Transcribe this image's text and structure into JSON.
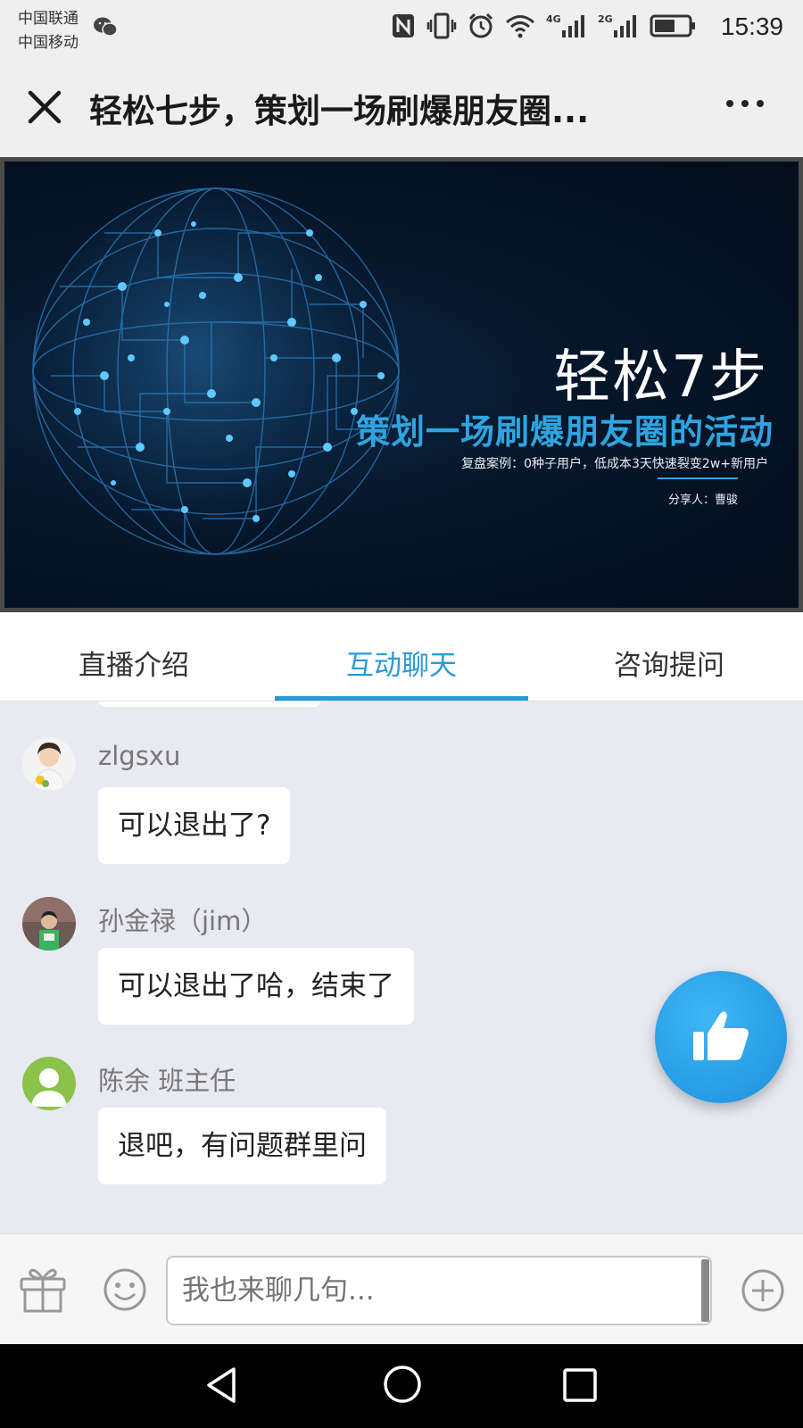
{
  "status_bar": {
    "carrier_1": "中国联通",
    "carrier_2": "中国移动",
    "time": "15:39",
    "icons": [
      "wechat-icon",
      "nfc-icon",
      "vibrate-icon",
      "alarm-icon",
      "wifi-icon",
      "signal-4g-icon",
      "signal-2g-icon",
      "battery-icon"
    ],
    "sig1_label": "4G",
    "sig2_label": "2G"
  },
  "header": {
    "title": "轻松七步，策划一场刷爆朋友圈...",
    "close_icon": "close-icon",
    "more_icon": "more-icon"
  },
  "banner": {
    "title": "轻松7步",
    "subtitle": "策划一场刷爆朋友圈的活动",
    "caption": "复盘案例：0种子用户，低成本3天快速裂变2w+新用户",
    "sharer": "分享人：曹骏"
  },
  "tabs": [
    {
      "label": "直播介绍",
      "active": false
    },
    {
      "label": "互动聊天",
      "active": true
    },
    {
      "label": "咨询提问",
      "active": false
    }
  ],
  "messages": [
    {
      "user": "zlgsxu",
      "text": "可以退出了?"
    },
    {
      "user": "孙金禄（jim）",
      "text": "可以退出了哈，结束了"
    },
    {
      "user": "陈余 班主任",
      "text": "退吧，有问题群里问"
    }
  ],
  "like_button": {
    "icon": "thumbs-up-icon"
  },
  "input_bar": {
    "placeholder": "我也来聊几句...",
    "icons": [
      "gift-icon",
      "emoji-icon",
      "plus-icon"
    ]
  },
  "nav_bar": {
    "icons": [
      "back-icon",
      "home-icon",
      "recent-apps-icon"
    ]
  },
  "colors": {
    "accent": "#2a9ad8",
    "chat_background": "#e8e9f1",
    "banner_background": "#06162a"
  }
}
